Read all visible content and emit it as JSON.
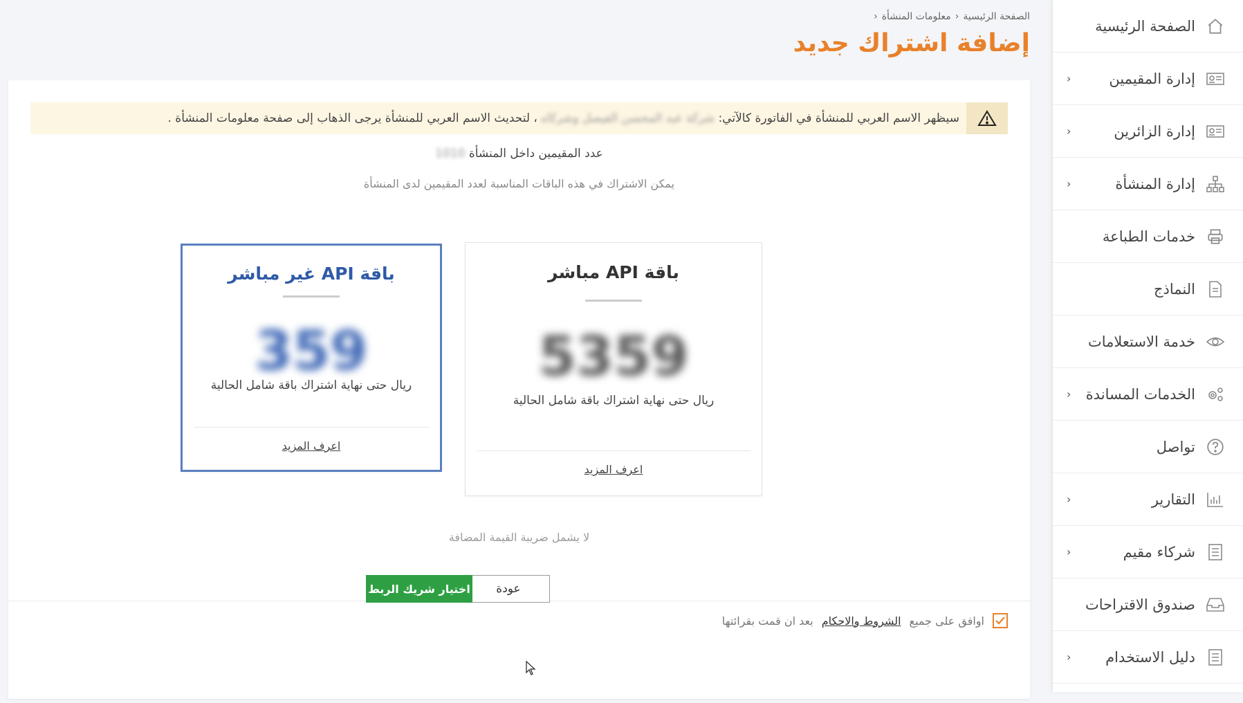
{
  "breadcrumb": {
    "home": "الصفحة الرئيسية",
    "establishment_info": "معلومات المنشأة"
  },
  "page": {
    "title": "إضافة اشتراك جديد"
  },
  "notice": {
    "text_before": "سيظهر الاسم العربي للمنشأة في الفاتورة كالآتي:",
    "blurred_name": "شركة عبد المحسن الفيصل وشركاه",
    "text_after": "، لتحديث الاسم العربي للمنشأة يرجى الذهاب إلى صفحة معلومات المنشأة ."
  },
  "residents": {
    "label": "عدد المقيمين داخل المنشأة",
    "count": "1010",
    "subtitle": "يمكن الاشتراك في هذه الباقات المناسبة لعدد المقيمين لدى المنشأة"
  },
  "packages": [
    {
      "title": "باقة API مباشر",
      "price": "5359",
      "desc": "ريال حتى نهاية اشتراك باقة شامل الحالية",
      "link": "اعرف المزيد"
    },
    {
      "title": "باقة API غير مباشر",
      "price": "359",
      "desc": "ريال حتى نهاية اشتراك باقة شامل الحالية",
      "link": "اعرف المزيد"
    }
  ],
  "vat_note": "لا يشمل ضريبة القيمة المضافة",
  "agreement": {
    "prefix": "اوافق على جميع",
    "terms": "الشروط والاحكام",
    "suffix": "بعد ان قمت بقرائتها",
    "checked": true
  },
  "buttons": {
    "back": "عودة",
    "choose_partner": "اختيار شريك الربط"
  },
  "sidebar": {
    "items": [
      {
        "label": "الصفحة الرئيسية",
        "icon": "home-icon",
        "has_chevron": false
      },
      {
        "label": "إدارة المقيمين",
        "icon": "id-card-icon",
        "has_chevron": true
      },
      {
        "label": "إدارة الزائرين",
        "icon": "id-card-icon",
        "has_chevron": true
      },
      {
        "label": "إدارة المنشأة",
        "icon": "org-chart-icon",
        "has_chevron": true
      },
      {
        "label": "خدمات الطباعة",
        "icon": "printer-icon",
        "has_chevron": false
      },
      {
        "label": "النماذج",
        "icon": "document-icon",
        "has_chevron": false
      },
      {
        "label": "خدمة الاستعلامات",
        "icon": "eye-icon",
        "has_chevron": false
      },
      {
        "label": "الخدمات المساندة",
        "icon": "gears-icon",
        "has_chevron": true
      },
      {
        "label": "تواصل",
        "icon": "help-icon",
        "has_chevron": false
      },
      {
        "label": "التقارير",
        "icon": "bar-chart-icon",
        "has_chevron": true
      },
      {
        "label": "شركاء مقيم",
        "icon": "list-icon",
        "has_chevron": true
      },
      {
        "label": "صندوق الاقتراحات",
        "icon": "inbox-icon",
        "has_chevron": false
      },
      {
        "label": "دليل الاستخدام",
        "icon": "book-icon",
        "has_chevron": true
      }
    ]
  },
  "colors": {
    "accent_orange": "#e8812a",
    "selected_blue": "#2e5aa6",
    "primary_green": "#2ea043",
    "notice_bg": "#fdf6e3"
  }
}
